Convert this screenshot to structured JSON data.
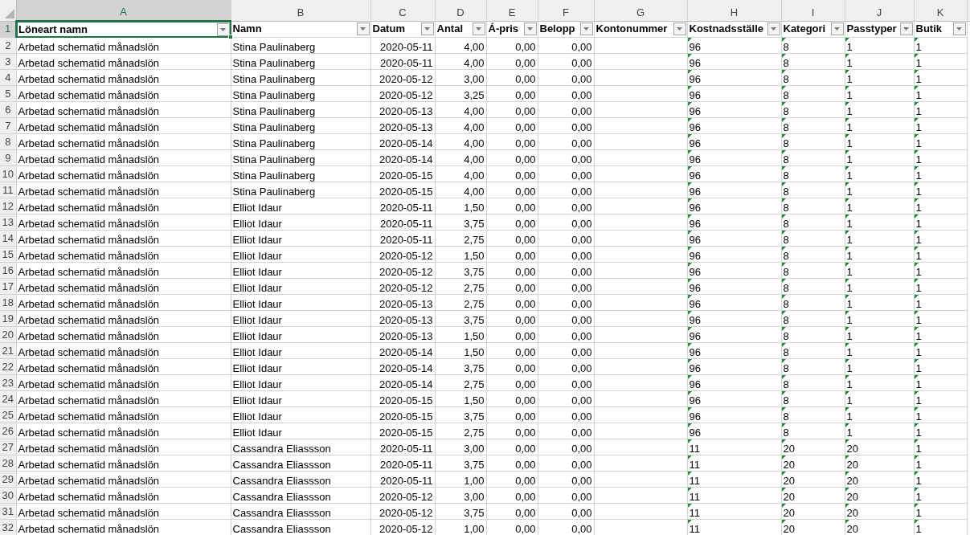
{
  "columns": [
    {
      "letter": "A",
      "header": "Löneart namn",
      "kind": "text",
      "selected": true
    },
    {
      "letter": "B",
      "header": "Namn",
      "kind": "text",
      "selected": false
    },
    {
      "letter": "C",
      "header": "Datum",
      "kind": "number",
      "selected": false
    },
    {
      "letter": "D",
      "header": "Antal",
      "kind": "number",
      "selected": false
    },
    {
      "letter": "E",
      "header": "Á-pris",
      "kind": "number",
      "selected": false
    },
    {
      "letter": "F",
      "header": "Belopp",
      "kind": "number",
      "selected": false
    },
    {
      "letter": "G",
      "header": "Kontonummer",
      "kind": "text",
      "selected": false
    },
    {
      "letter": "H",
      "header": "Kostnadsställe",
      "kind": "number_as_text",
      "selected": false
    },
    {
      "letter": "I",
      "header": "Kategori",
      "kind": "number_as_text",
      "selected": false
    },
    {
      "letter": "J",
      "header": "Passtyper",
      "kind": "number_as_text",
      "selected": false
    },
    {
      "letter": "K",
      "header": "Butik",
      "kind": "number_as_text",
      "selected": false
    }
  ],
  "header_row": {
    "number": "1",
    "selected": true
  },
  "rows": [
    {
      "number": "2",
      "cells": [
        "Arbetad schematid månadslön",
        "Stina Paulinaberg",
        "2020-05-11",
        "4,00",
        "0,00",
        "0,00",
        null,
        "96",
        "8",
        "1",
        "1"
      ]
    },
    {
      "number": "3",
      "cells": [
        "Arbetad schematid månadslön",
        "Stina Paulinaberg",
        "2020-05-11",
        "4,00",
        "0,00",
        "0,00",
        null,
        "96",
        "8",
        "1",
        "1"
      ]
    },
    {
      "number": "4",
      "cells": [
        "Arbetad schematid månadslön",
        "Stina Paulinaberg",
        "2020-05-12",
        "3,00",
        "0,00",
        "0,00",
        null,
        "96",
        "8",
        "1",
        "1"
      ]
    },
    {
      "number": "5",
      "cells": [
        "Arbetad schematid månadslön",
        "Stina Paulinaberg",
        "2020-05-12",
        "3,25",
        "0,00",
        "0,00",
        null,
        "96",
        "8",
        "1",
        "1"
      ]
    },
    {
      "number": "6",
      "cells": [
        "Arbetad schematid månadslön",
        "Stina Paulinaberg",
        "2020-05-13",
        "4,00",
        "0,00",
        "0,00",
        null,
        "96",
        "8",
        "1",
        "1"
      ]
    },
    {
      "number": "7",
      "cells": [
        "Arbetad schematid månadslön",
        "Stina Paulinaberg",
        "2020-05-13",
        "4,00",
        "0,00",
        "0,00",
        null,
        "96",
        "8",
        "1",
        "1"
      ]
    },
    {
      "number": "8",
      "cells": [
        "Arbetad schematid månadslön",
        "Stina Paulinaberg",
        "2020-05-14",
        "4,00",
        "0,00",
        "0,00",
        null,
        "96",
        "8",
        "1",
        "1"
      ]
    },
    {
      "number": "9",
      "cells": [
        "Arbetad schematid månadslön",
        "Stina Paulinaberg",
        "2020-05-14",
        "4,00",
        "0,00",
        "0,00",
        null,
        "96",
        "8",
        "1",
        "1"
      ]
    },
    {
      "number": "10",
      "cells": [
        "Arbetad schematid månadslön",
        "Stina Paulinaberg",
        "2020-05-15",
        "4,00",
        "0,00",
        "0,00",
        null,
        "96",
        "8",
        "1",
        "1"
      ]
    },
    {
      "number": "11",
      "cells": [
        "Arbetad schematid månadslön",
        "Stina Paulinaberg",
        "2020-05-15",
        "4,00",
        "0,00",
        "0,00",
        null,
        "96",
        "8",
        "1",
        "1"
      ]
    },
    {
      "number": "12",
      "cells": [
        "Arbetad schematid månadslön",
        "Elliot Idaur",
        "2020-05-11",
        "1,50",
        "0,00",
        "0,00",
        null,
        "96",
        "8",
        "1",
        "1"
      ]
    },
    {
      "number": "13",
      "cells": [
        "Arbetad schematid månadslön",
        "Elliot Idaur",
        "2020-05-11",
        "3,75",
        "0,00",
        "0,00",
        null,
        "96",
        "8",
        "1",
        "1"
      ]
    },
    {
      "number": "14",
      "cells": [
        "Arbetad schematid månadslön",
        "Elliot Idaur",
        "2020-05-11",
        "2,75",
        "0,00",
        "0,00",
        null,
        "96",
        "8",
        "1",
        "1"
      ]
    },
    {
      "number": "15",
      "cells": [
        "Arbetad schematid månadslön",
        "Elliot Idaur",
        "2020-05-12",
        "1,50",
        "0,00",
        "0,00",
        null,
        "96",
        "8",
        "1",
        "1"
      ]
    },
    {
      "number": "16",
      "cells": [
        "Arbetad schematid månadslön",
        "Elliot Idaur",
        "2020-05-12",
        "3,75",
        "0,00",
        "0,00",
        null,
        "96",
        "8",
        "1",
        "1"
      ]
    },
    {
      "number": "17",
      "cells": [
        "Arbetad schematid månadslön",
        "Elliot Idaur",
        "2020-05-12",
        "2,75",
        "0,00",
        "0,00",
        null,
        "96",
        "8",
        "1",
        "1"
      ]
    },
    {
      "number": "18",
      "cells": [
        "Arbetad schematid månadslön",
        "Elliot Idaur",
        "2020-05-13",
        "2,75",
        "0,00",
        "0,00",
        null,
        "96",
        "8",
        "1",
        "1"
      ]
    },
    {
      "number": "19",
      "cells": [
        "Arbetad schematid månadslön",
        "Elliot Idaur",
        "2020-05-13",
        "3,75",
        "0,00",
        "0,00",
        null,
        "96",
        "8",
        "1",
        "1"
      ]
    },
    {
      "number": "20",
      "cells": [
        "Arbetad schematid månadslön",
        "Elliot Idaur",
        "2020-05-13",
        "1,50",
        "0,00",
        "0,00",
        null,
        "96",
        "8",
        "1",
        "1"
      ]
    },
    {
      "number": "21",
      "cells": [
        "Arbetad schematid månadslön",
        "Elliot Idaur",
        "2020-05-14",
        "1,50",
        "0,00",
        "0,00",
        null,
        "96",
        "8",
        "1",
        "1"
      ]
    },
    {
      "number": "22",
      "cells": [
        "Arbetad schematid månadslön",
        "Elliot Idaur",
        "2020-05-14",
        "3,75",
        "0,00",
        "0,00",
        null,
        "96",
        "8",
        "1",
        "1"
      ]
    },
    {
      "number": "23",
      "cells": [
        "Arbetad schematid månadslön",
        "Elliot Idaur",
        "2020-05-14",
        "2,75",
        "0,00",
        "0,00",
        null,
        "96",
        "8",
        "1",
        "1"
      ]
    },
    {
      "number": "24",
      "cells": [
        "Arbetad schematid månadslön",
        "Elliot Idaur",
        "2020-05-15",
        "1,50",
        "0,00",
        "0,00",
        null,
        "96",
        "8",
        "1",
        "1"
      ]
    },
    {
      "number": "25",
      "cells": [
        "Arbetad schematid månadslön",
        "Elliot Idaur",
        "2020-05-15",
        "3,75",
        "0,00",
        "0,00",
        null,
        "96",
        "8",
        "1",
        "1"
      ]
    },
    {
      "number": "26",
      "cells": [
        "Arbetad schematid månadslön",
        "Elliot Idaur",
        "2020-05-15",
        "2,75",
        "0,00",
        "0,00",
        null,
        "96",
        "8",
        "1",
        "1"
      ]
    },
    {
      "number": "27",
      "cells": [
        "Arbetad schematid månadslön",
        "Cassandra Eliassson",
        "2020-05-11",
        "3,00",
        "0,00",
        "0,00",
        null,
        "11",
        "20",
        "20",
        "1"
      ]
    },
    {
      "number": "28",
      "cells": [
        "Arbetad schematid månadslön",
        "Cassandra Eliassson",
        "2020-05-11",
        "3,75",
        "0,00",
        "0,00",
        null,
        "11",
        "20",
        "20",
        "1"
      ]
    },
    {
      "number": "29",
      "cells": [
        "Arbetad schematid månadslön",
        "Cassandra Eliassson",
        "2020-05-11",
        "1,00",
        "0,00",
        "0,00",
        null,
        "11",
        "20",
        "20",
        "1"
      ]
    },
    {
      "number": "30",
      "cells": [
        "Arbetad schematid månadslön",
        "Cassandra Eliassson",
        "2020-05-12",
        "3,00",
        "0,00",
        "0,00",
        null,
        "11",
        "20",
        "20",
        "1"
      ]
    },
    {
      "number": "31",
      "cells": [
        "Arbetad schematid månadslön",
        "Cassandra Eliassson",
        "2020-05-12",
        "3,75",
        "0,00",
        "0,00",
        null,
        "11",
        "20",
        "20",
        "1"
      ]
    },
    {
      "number": "32",
      "cells": [
        "Arbetad schematid månadslön",
        "Cassandra Eliassson",
        "2020-05-12",
        "1,00",
        "0,00",
        "0,00",
        null,
        "11",
        "20",
        "20",
        "1"
      ]
    }
  ]
}
